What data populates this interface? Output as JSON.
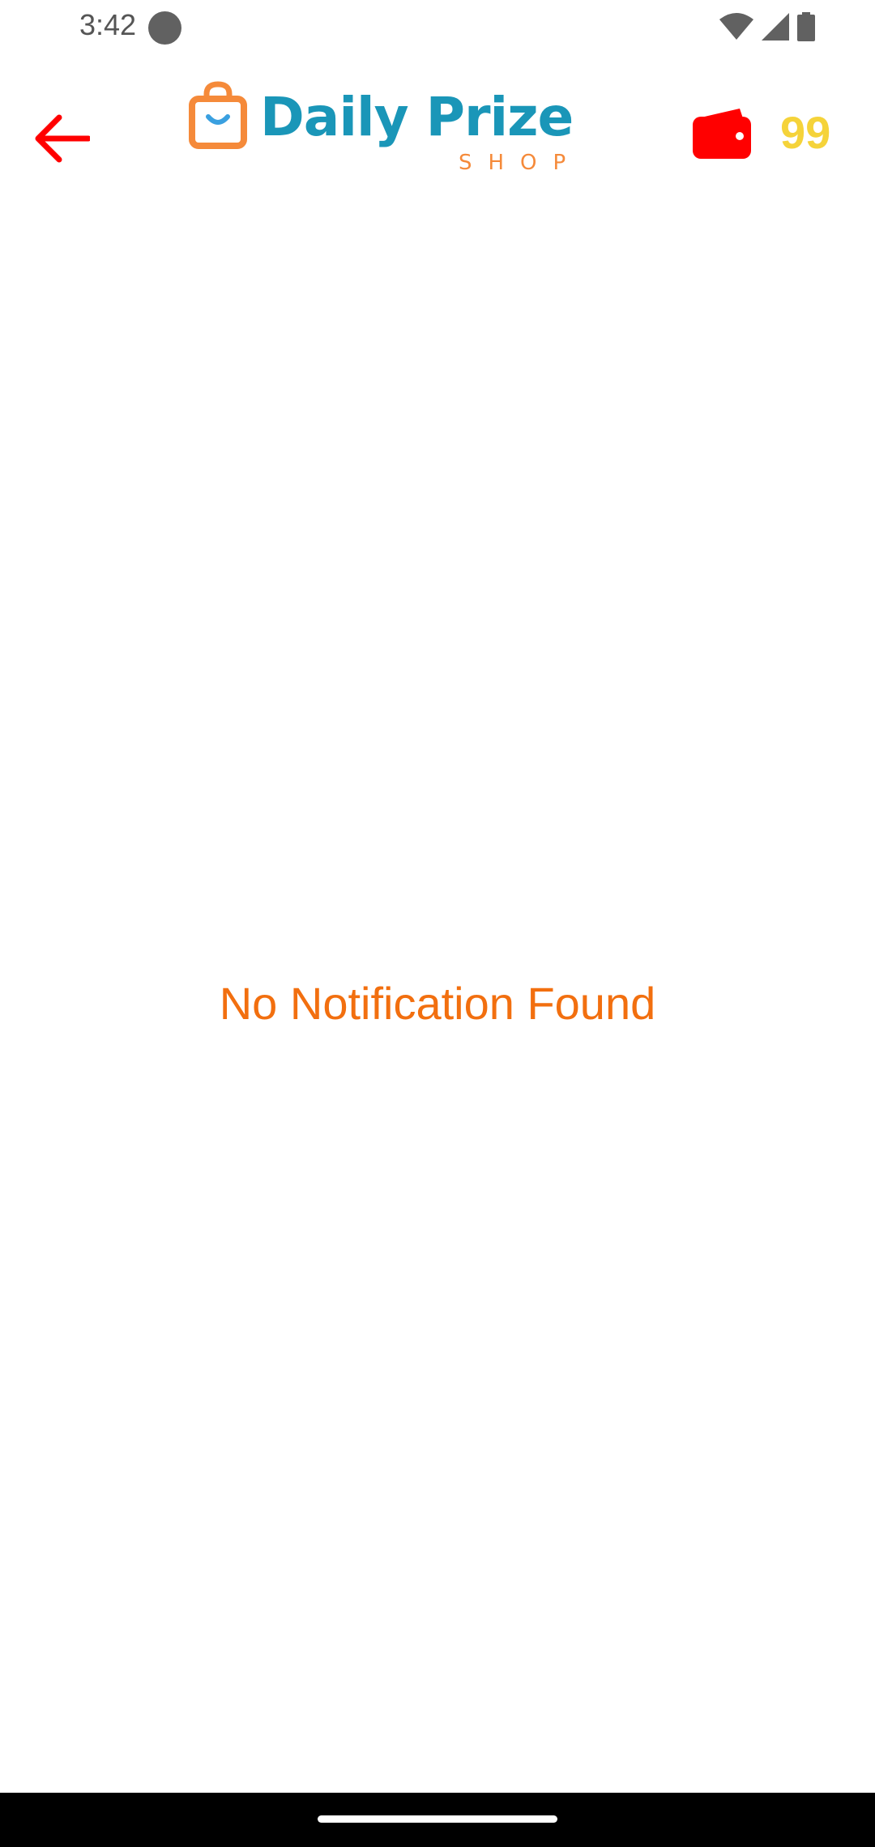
{
  "status_bar": {
    "time": "3:42",
    "icons": [
      "record-dot-icon",
      "wifi-icon",
      "cellular-signal-icon",
      "battery-icon"
    ]
  },
  "header": {
    "back_icon": "arrow-left-icon",
    "logo": {
      "title": "Daily Prize",
      "subtitle": "SHOP",
      "icon": "shopping-bag-icon"
    },
    "wallet": {
      "icon": "wallet-icon",
      "balance": "99"
    }
  },
  "main": {
    "empty_message": "No Notification Found"
  },
  "colors": {
    "accent_red": "#ff0000",
    "logo_teal": "#1a96b8",
    "logo_orange": "#f58a3a",
    "balance_yellow": "#f5d33a",
    "message_orange": "#f26f0f"
  }
}
